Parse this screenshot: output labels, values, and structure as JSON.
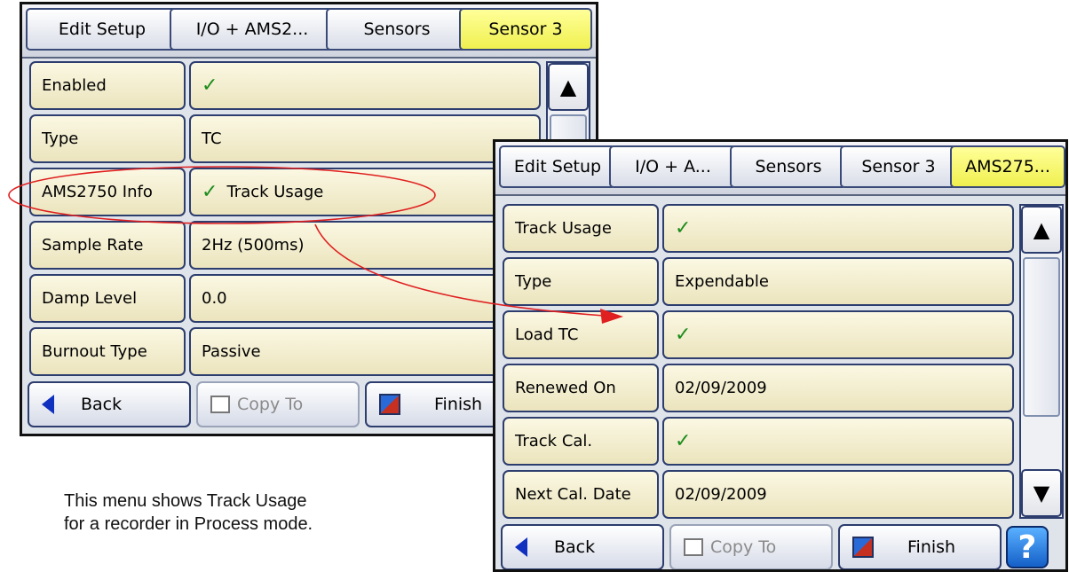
{
  "screen1": {
    "breadcrumbs": [
      "Edit Setup",
      "I/O + AMS2...",
      "Sensors",
      "Sensor 3"
    ],
    "rows": [
      {
        "label": "Enabled",
        "value": "",
        "check": true
      },
      {
        "label": "Type",
        "value": "TC",
        "check": false
      },
      {
        "label": "AMS2750 Info",
        "value": "Track Usage",
        "check": true
      },
      {
        "label": "Sample Rate",
        "value": "2Hz (500ms)",
        "check": false
      },
      {
        "label": "Damp Level",
        "value": "0.0",
        "check": false
      },
      {
        "label": "Burnout Type",
        "value": "Passive",
        "check": false
      }
    ],
    "buttons": {
      "back": "Back",
      "copy": "Copy To",
      "finish": "Finish"
    }
  },
  "screen2": {
    "breadcrumbs": [
      "Edit Setup",
      "I/O + A...",
      "Sensors",
      "Sensor 3",
      "AMS275..."
    ],
    "rows": [
      {
        "label": "Track Usage",
        "value": "",
        "check": true
      },
      {
        "label": "Type",
        "value": "Expendable",
        "check": false
      },
      {
        "label": "Load TC",
        "value": "",
        "check": true
      },
      {
        "label": "Renewed On",
        "value": "02/09/2009",
        "check": false
      },
      {
        "label": "Track Cal.",
        "value": "",
        "check": true
      },
      {
        "label": "Next Cal. Date",
        "value": "02/09/2009",
        "check": false
      }
    ],
    "buttons": {
      "back": "Back",
      "copy": "Copy To",
      "finish": "Finish",
      "help": "?"
    }
  },
  "caption": {
    "line1": "This menu shows Track Usage",
    "line2": "for a recorder in Process mode."
  },
  "symbols": {
    "check": "✓",
    "up": "▲",
    "down": "▼"
  },
  "colors": {
    "active_crumb": "#ffff66",
    "highlight": "#e02020",
    "check": "#1c8c1c"
  }
}
